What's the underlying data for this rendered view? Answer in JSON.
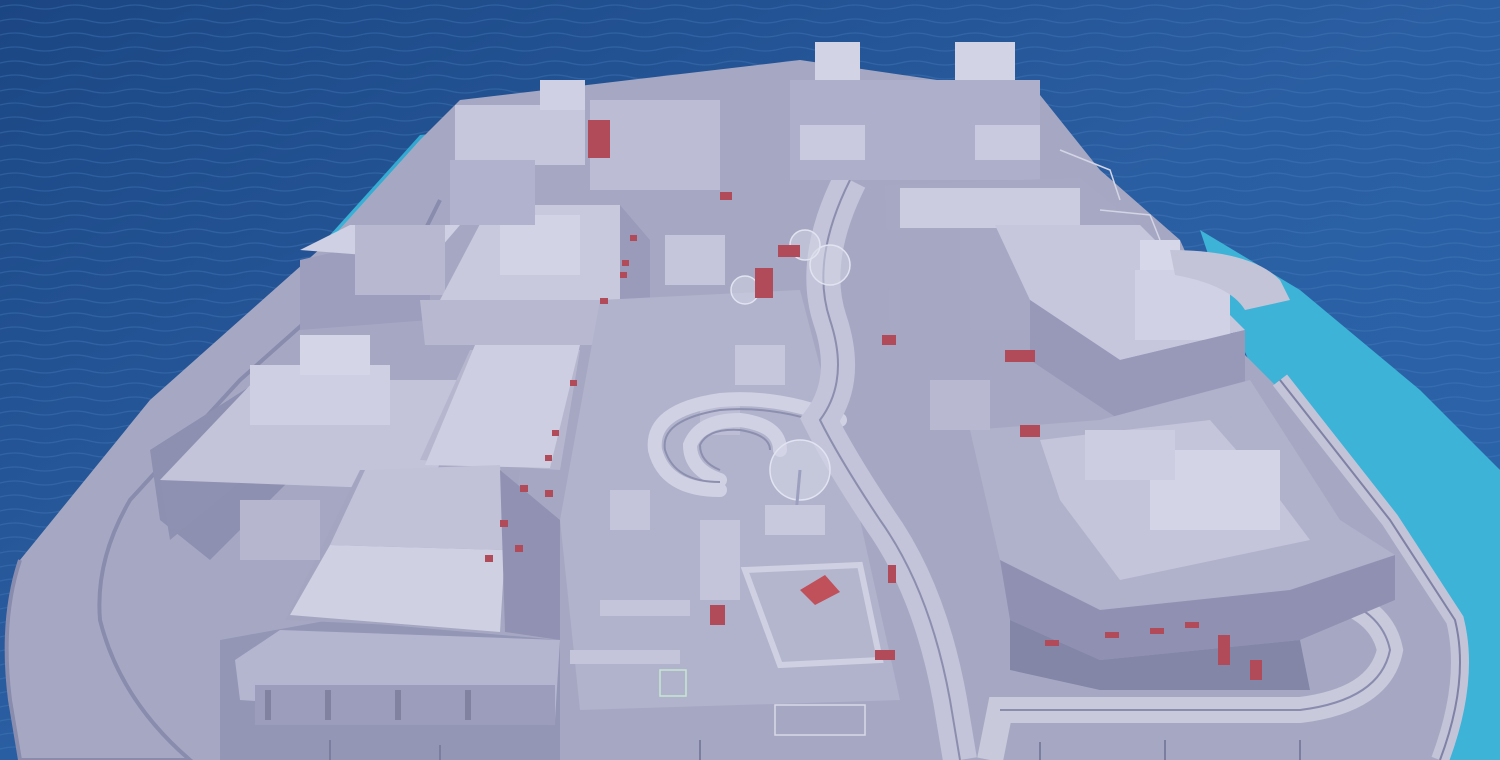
{
  "scene": {
    "description_free": true,
    "colors": {
      "ocean_deep": "#1d4a86",
      "ocean_mid": "#2d64a6",
      "ocean_light": "#3b78bd",
      "shallow_water": "#3fb6d6",
      "ground": "#a7a9c4",
      "ground_shadow": "#7d7fa3",
      "roof": "#c9c9dd",
      "roof_light": "#d8d8e8",
      "wall": "#9e9fbe",
      "wall_dark": "#8182a6",
      "accent_red": "#c0505a"
    },
    "elements": {
      "island": "island-platform",
      "road": "perimeter-road",
      "ramp": "spiral-ramp",
      "trees": "tree-icon"
    }
  }
}
